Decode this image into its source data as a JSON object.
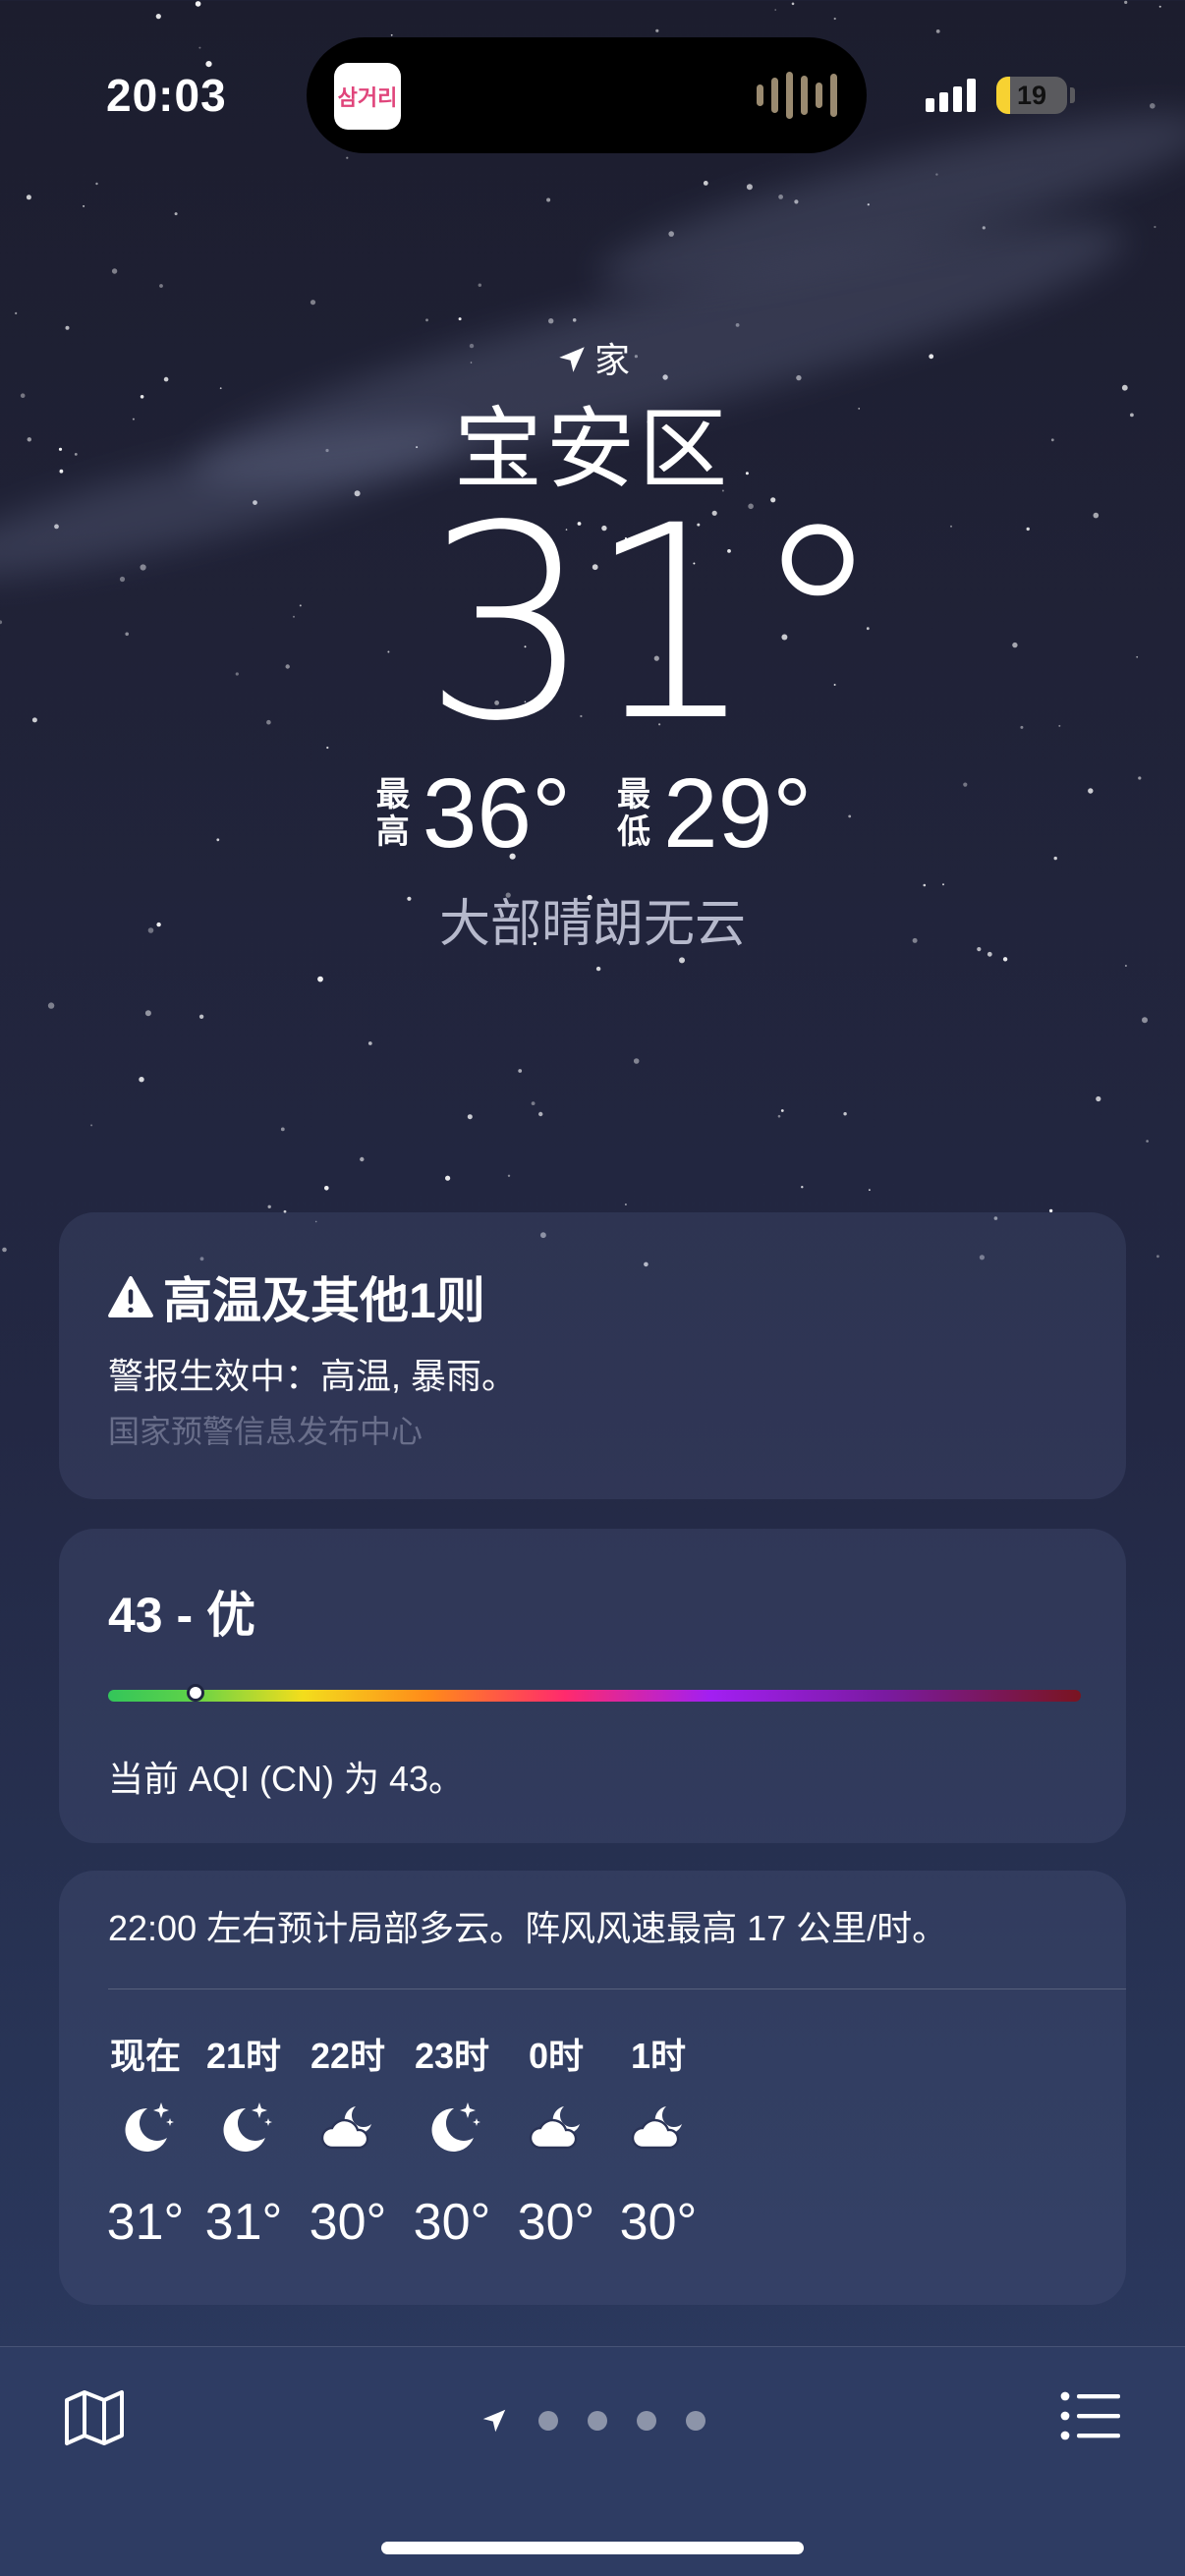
{
  "status_bar": {
    "time": "20:03",
    "battery_level": "19",
    "battery_fraction": 0.19
  },
  "dynamic_island": {
    "app_icon": "app-icon",
    "app_text": "삼거리"
  },
  "location": {
    "badge": "家",
    "city": "宝安区"
  },
  "current": {
    "temperature": "31°",
    "high_label": "最高",
    "high": "36°",
    "low_label": "最低",
    "low": "29°",
    "condition": "大部晴朗无云"
  },
  "alert": {
    "title": "高温及其他1则",
    "body": "警报生效中：高温, 暴雨。",
    "source": "国家预警信息发布中心",
    "icon": "warning-icon"
  },
  "aqi": {
    "title": "43 - 优",
    "value": 43,
    "scale_fraction": 0.09,
    "description": "当前 AQI (CN) 为 43。"
  },
  "hourly": {
    "summary": "22:00 左右预计局部多云。阵风风速最高 17 公里/时。",
    "items": [
      {
        "hour": "现在",
        "icon": "moon-stars-icon",
        "temp": "31°"
      },
      {
        "hour": "21时",
        "icon": "moon-stars-icon",
        "temp": "31°"
      },
      {
        "hour": "22时",
        "icon": "cloud-moon-icon",
        "temp": "30°"
      },
      {
        "hour": "23时",
        "icon": "moon-stars-icon",
        "temp": "30°"
      },
      {
        "hour": "0时",
        "icon": "cloud-moon-icon",
        "temp": "30°"
      },
      {
        "hour": "1时",
        "icon": "cloud-moon-icon",
        "temp": "30°"
      }
    ]
  },
  "bottom_bar": {
    "map_icon": "map-icon",
    "list_icon": "list-icon",
    "page_count": 5,
    "current_page": "location-arrow-icon"
  },
  "colors": {
    "background_top": "#1c1d2e",
    "background_bottom": "#2d3b63",
    "battery": "#f7d232"
  }
}
